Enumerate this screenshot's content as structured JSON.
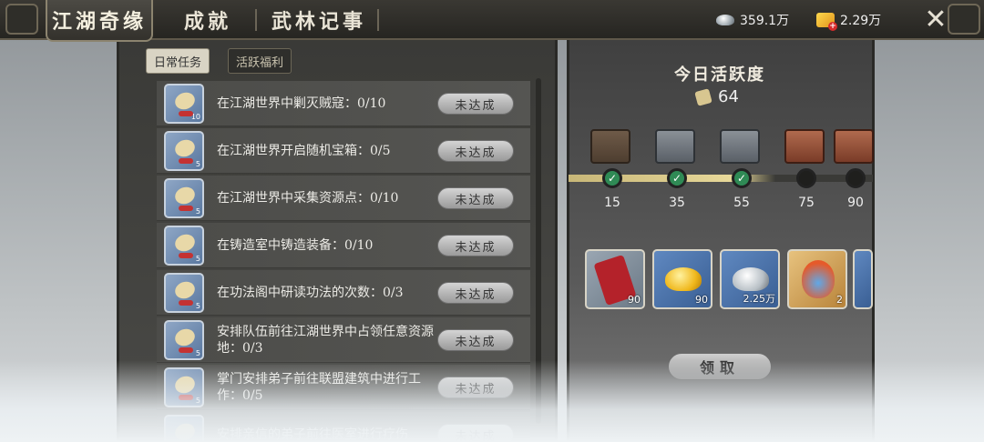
{
  "header": {
    "tabs": [
      {
        "label": "江湖奇缘",
        "active": true
      },
      {
        "label": "成就",
        "active": false
      },
      {
        "label": "武林记事",
        "active": false
      }
    ],
    "silver": "359.1万",
    "gold": "2.29万",
    "close_icon": "close-cross-icon"
  },
  "subtabs": [
    {
      "label": "日常任务",
      "active": true
    },
    {
      "label": "活跃福利",
      "active": false
    }
  ],
  "tasks": [
    {
      "text": "在江湖世界中剿灭贼寇：0/10",
      "icon_num": "10",
      "status": "未达成"
    },
    {
      "text": "在江湖世界开启随机宝箱：0/5",
      "icon_num": "5",
      "status": "未达成"
    },
    {
      "text": "在江湖世界中采集资源点：0/10",
      "icon_num": "5",
      "status": "未达成"
    },
    {
      "text": "在铸造室中铸造装备：0/10",
      "icon_num": "5",
      "status": "未达成"
    },
    {
      "text": "在功法阁中研读功法的次数：0/3",
      "icon_num": "5",
      "status": "未达成"
    },
    {
      "text": "安排队伍前往江湖世界中占领任意资源地：0/3",
      "icon_num": "5",
      "status": "未达成"
    },
    {
      "text": "掌门安排弟子前往联盟建筑中进行工作：0/5",
      "icon_num": "5",
      "status": "未达成"
    },
    {
      "text": "安排亲信的弟子前往医室进行疗伤",
      "icon_num": "5",
      "status": "未达成"
    }
  ],
  "activity": {
    "title": "今日活跃度",
    "value": "64",
    "progress_fraction": 0.64,
    "milestones": [
      {
        "value": "15",
        "done": true,
        "chest": "open"
      },
      {
        "value": "35",
        "done": true,
        "chest": "iron"
      },
      {
        "value": "55",
        "done": true,
        "chest": "iron"
      },
      {
        "value": "75",
        "done": false,
        "chest": "red"
      },
      {
        "value": "90",
        "done": false,
        "chest": "red"
      }
    ],
    "check_mark": "✓"
  },
  "rewards": [
    {
      "qty": "90",
      "icon": "red-pouch-icon"
    },
    {
      "qty": "90",
      "icon": "gold-ingot-icon"
    },
    {
      "qty": "2.25万",
      "icon": "silver-ingot-icon"
    },
    {
      "qty": "2",
      "icon": "flame-token-icon"
    }
  ],
  "claim_label": "领取"
}
